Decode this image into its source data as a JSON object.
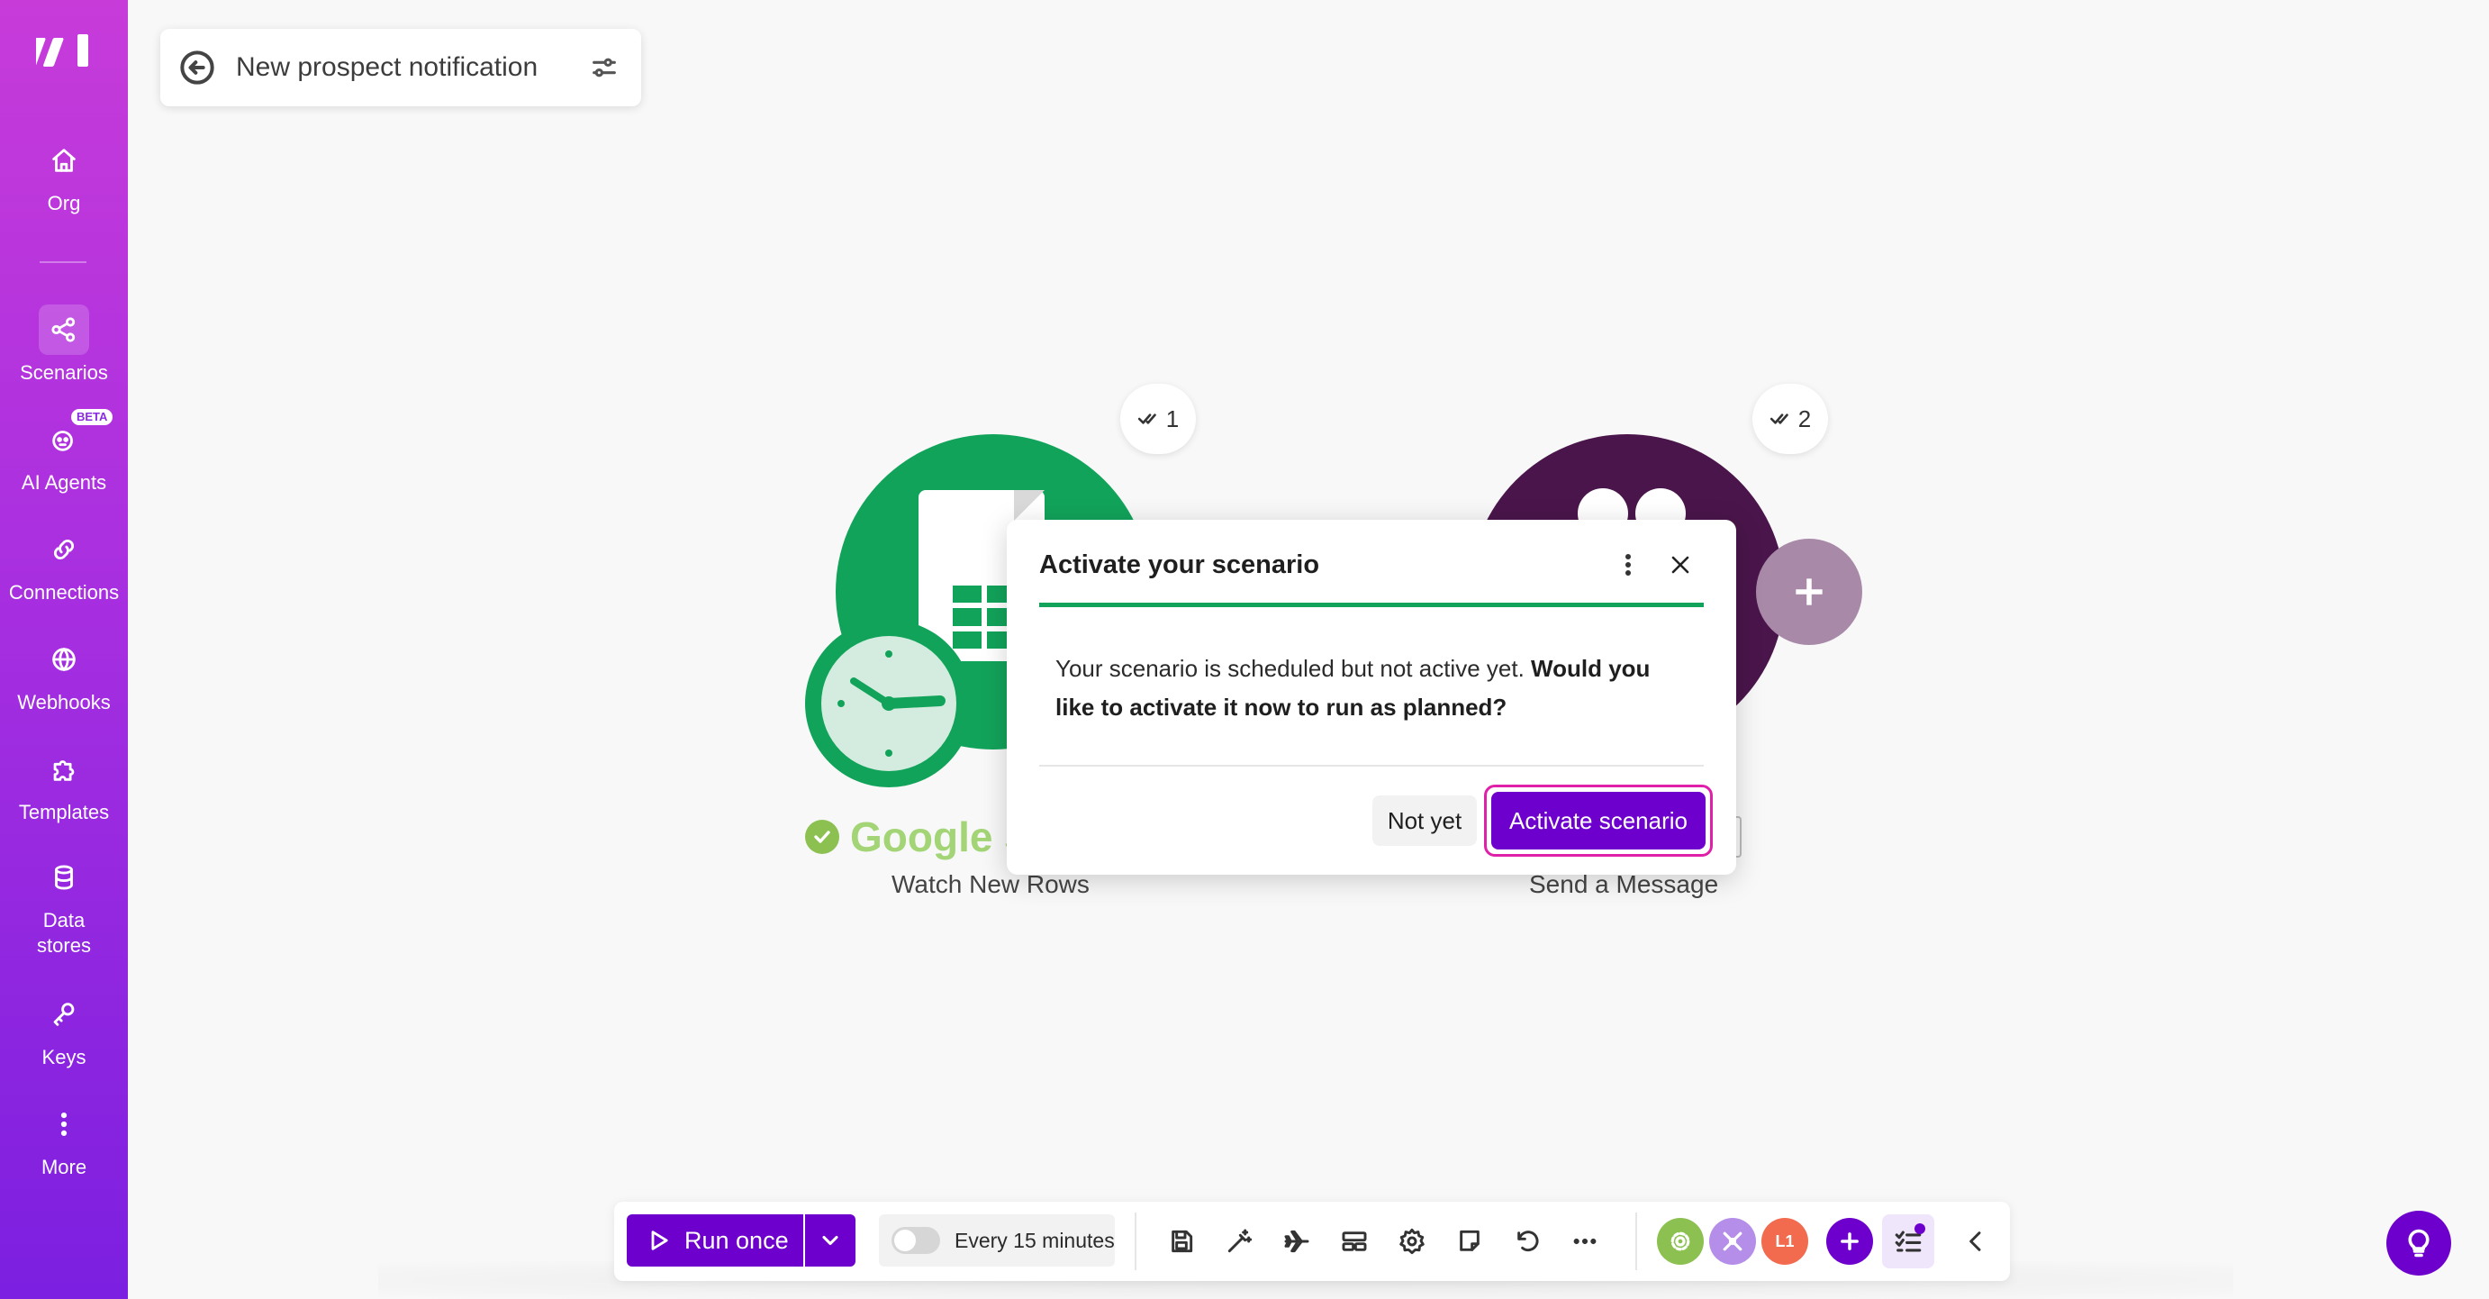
{
  "colors": {
    "brand_purple": "#6d00cc",
    "sidebar_top": "#c73bd9",
    "sidebar_bottom": "#7c1fe0",
    "sheets_green": "#12a35a",
    "slack_aubergine": "#4a154b",
    "highlight_ring": "#e020a8"
  },
  "sidebar": {
    "logo_icon": "make-logo-icon",
    "items": [
      {
        "label": "Org",
        "icon": "home-icon",
        "active": false
      },
      {
        "label": "Scenarios",
        "icon": "share-icon",
        "active": true
      },
      {
        "label": "AI Agents",
        "icon": "ai-agent-icon",
        "badge": "BETA",
        "active": false
      },
      {
        "label": "Connections",
        "icon": "link-icon",
        "active": false
      },
      {
        "label": "Webhooks",
        "icon": "globe-icon",
        "active": false
      },
      {
        "label": "Templates",
        "icon": "puzzle-icon",
        "active": false
      },
      {
        "label": "Data stores",
        "icon": "database-icon",
        "active": false
      },
      {
        "label": "Keys",
        "icon": "key-icon",
        "active": false
      },
      {
        "label": "More",
        "icon": "more-vertical-icon",
        "active": false
      }
    ]
  },
  "header": {
    "title": "New prospect notification",
    "back_icon": "back-arrow-icon",
    "settings_icon": "sliders-icon"
  },
  "canvas": {
    "modules": [
      {
        "id": 1,
        "badge": "1",
        "app_name": "Google S",
        "action": "Watch New Rows",
        "icon": "google-sheets-icon",
        "status": "configured"
      },
      {
        "id": 2,
        "badge": "2",
        "app_name": "",
        "action": "Send a Message",
        "icon": "slack-icon"
      }
    ],
    "add_module_icon": "plus-icon"
  },
  "dialog": {
    "title": "Activate your scenario",
    "body_plain": "Your scenario is scheduled but not active yet. ",
    "body_bold": "Would you like to activate it now to run as planned?",
    "secondary_label": "Not yet",
    "primary_label": "Activate scenario"
  },
  "toolbar": {
    "run_once_label": "Run once",
    "schedule_label": "Every 15 minutes",
    "schedule_enabled": false,
    "tools": [
      "save-icon",
      "magic-wand-icon",
      "airplane-icon",
      "route-icon",
      "gear-icon",
      "note-icon",
      "undo-icon",
      "more-horizontal-icon"
    ],
    "collaborators": [
      {
        "icon": "gear-icon",
        "color": "#8cc152"
      },
      {
        "icon": "tools-icon",
        "color": "#b48ee8"
      },
      {
        "initials": "L1",
        "color": "#f26b4f"
      }
    ]
  }
}
